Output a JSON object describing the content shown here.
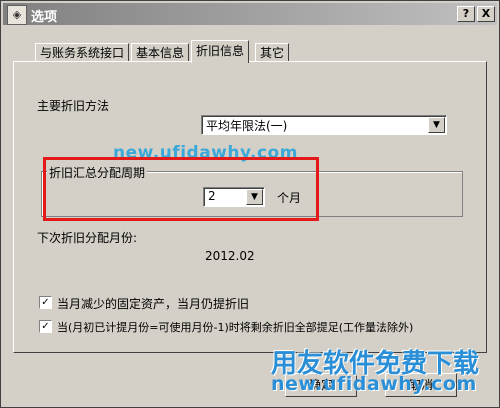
{
  "window": {
    "title": "选项",
    "help_button": "?",
    "close_button": "X"
  },
  "tabs": [
    {
      "label": "与账务系统接口",
      "active": false
    },
    {
      "label": "基本信息",
      "active": false
    },
    {
      "label": "折旧信息",
      "active": true
    },
    {
      "label": "其它",
      "active": false
    }
  ],
  "depreciation": {
    "method_label": "主要折旧方法",
    "method_value": "平均年限法(一)",
    "period_group_title": "折旧汇总分配周期",
    "period_value": "2",
    "period_unit": "个月",
    "next_month_label": "下次折旧分配月份:",
    "next_month_value": "2012.02"
  },
  "options": [
    {
      "label": "当月减少的固定资产，当月仍提折旧",
      "checked": true
    },
    {
      "label": "当(月初已计提月份=可使用月份-1)时将剩余折旧全部提足(工作量法除外)",
      "checked": true
    }
  ],
  "buttons": {
    "ok": "确定",
    "cancel": "取消"
  },
  "watermarks": {
    "url_top": "new.ufidawhy.com",
    "title": "用友软件免费下载",
    "url_bottom": "new.ufidawhy.com"
  },
  "colors": {
    "highlight_box": "#e41a1a",
    "watermark": "#2a8fd6"
  }
}
